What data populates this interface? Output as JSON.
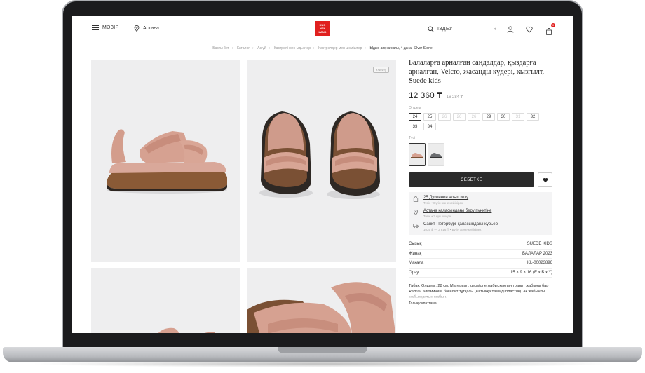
{
  "header": {
    "menu_label": "МӘЗІР",
    "city": "Астана",
    "logo_lines": [
      "KUC",
      "HEN",
      "LAND"
    ],
    "search_value": "ІЗДЕУ",
    "cart_count": "0"
  },
  "breadcrumb": [
    "Басты бет",
    "Каталог",
    "Ас үй",
    "Кастрөлі мен ыдыстар",
    "Кастрөлдер мен шөміштер",
    "Ыдыс-аяқ жинағы, 4 дана, Silver Stone"
  ],
  "gallery": {
    "try_on_label": "Үлкейту"
  },
  "product": {
    "title": "Балаларға арналған сандалдар, қыздарға арналған, Velcro, жасанды күдері, қызғылт, Suede kids",
    "price": "12 360 ₸",
    "old_price": "16 284 ₸",
    "size_label": "Өлшемі",
    "sizes": [
      {
        "v": "24",
        "state": "sel"
      },
      {
        "v": "25",
        "state": ""
      },
      {
        "v": "26",
        "state": "na"
      },
      {
        "v": "26",
        "state": "na"
      },
      {
        "v": "26",
        "state": "na"
      },
      {
        "v": "29",
        "state": ""
      },
      {
        "v": "30",
        "state": ""
      },
      {
        "v": "31",
        "state": "na"
      },
      {
        "v": "32",
        "state": ""
      },
      {
        "v": "33",
        "state": ""
      },
      {
        "v": "34",
        "state": ""
      }
    ],
    "color_label": "Түсі",
    "add_to_cart": "СЕБЕТКЕ"
  },
  "delivery": [
    {
      "title": "25 Дүкеннен алып кету",
      "sub": "Тегін • Бүгін және кейінірек",
      "icon": "bag-icon"
    },
    {
      "title": "Астана қаласындағы беру пунктіне",
      "sub": "Тегін • 3 күн ішінде",
      "icon": "location-pin-icon"
    },
    {
      "title": "Санкт-Петербург қаласындағы курьер",
      "sub": "1035 ₽ — 3 816 ₸ • Бүгін және кейінірек",
      "icon": "truck-icon"
    }
  ],
  "specs": [
    {
      "k": "Сызық",
      "v": "SUEDE KIDS"
    },
    {
      "k": "Жинақ",
      "v": "БАЛАЛАР 2023"
    },
    {
      "k": "Мақала",
      "v": "KL-00023896"
    },
    {
      "k": "Орау",
      "v": "15 × 9 × 16 (Е х Б х Ү)"
    }
  ],
  "description": "Табақ. Өлшемі: 28 см. Материал: geostone жабысқақтын гранит жабыны бар жалған алюминий; бакелит тұтқасы (ыстыққа төзімді пластик). Ұқ жабынты жабысқақтын жабын.",
  "full_description_link": "Толық сипаттама"
}
